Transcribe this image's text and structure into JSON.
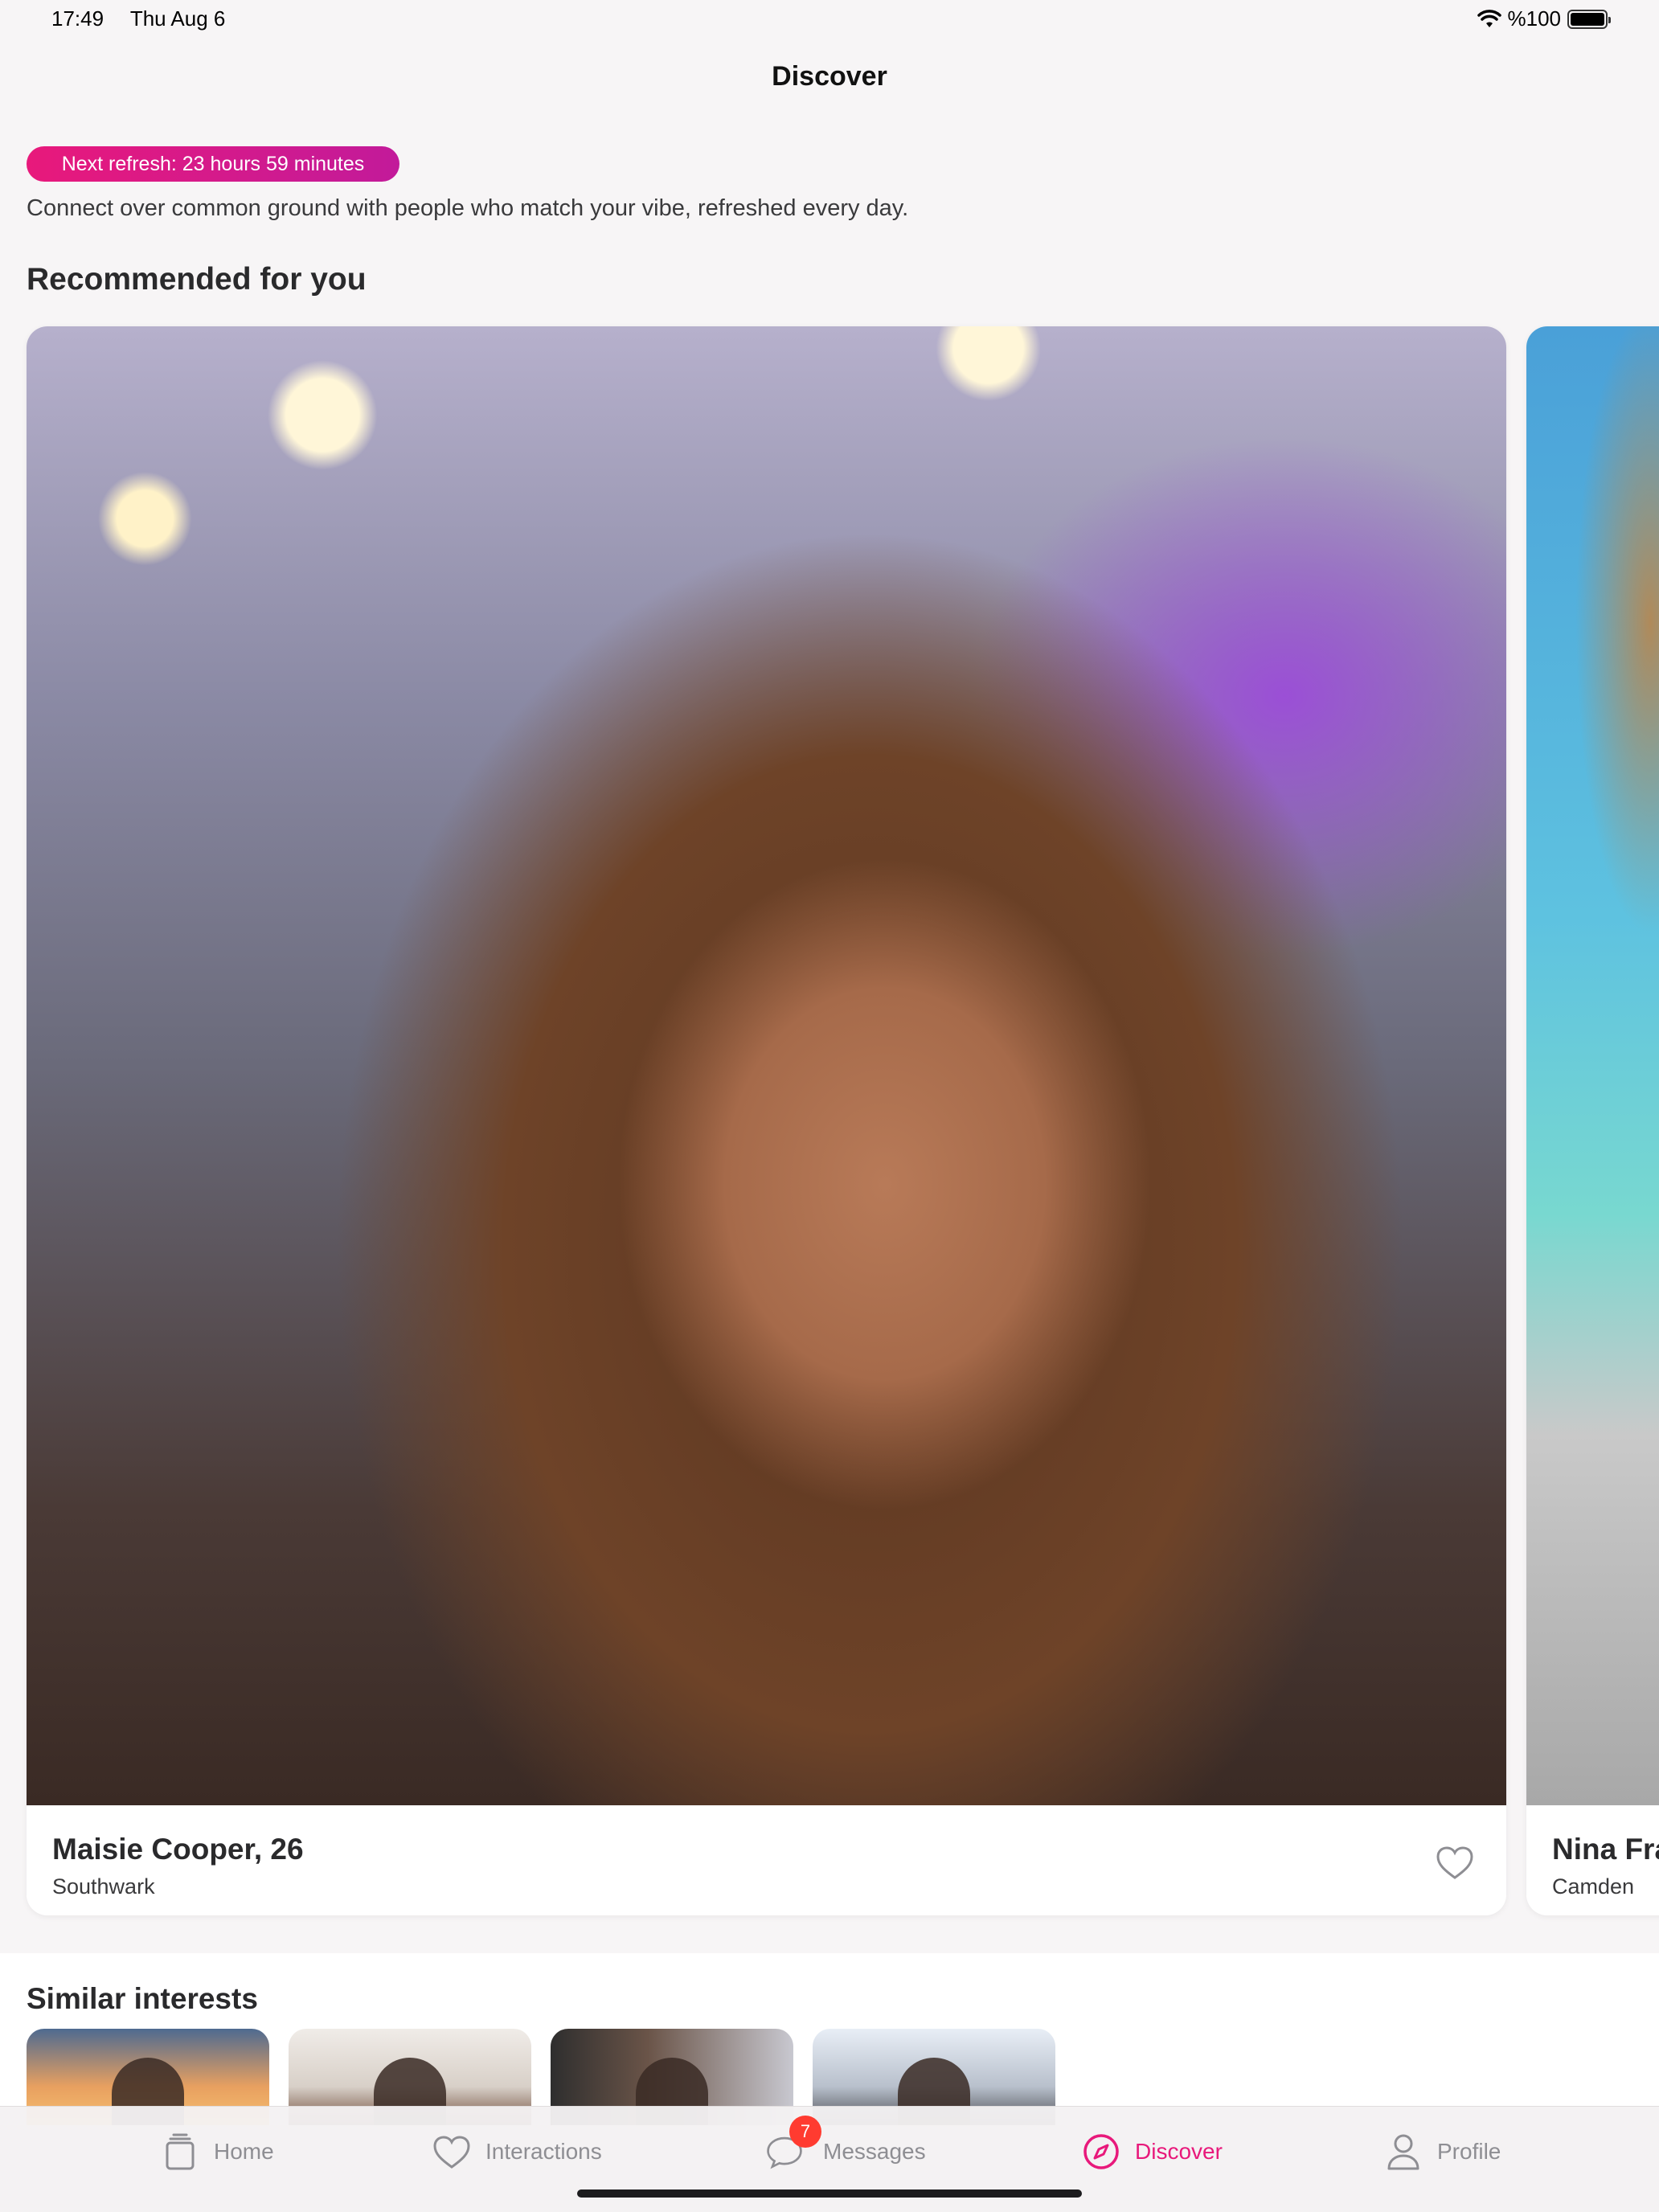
{
  "status_bar": {
    "time": "17:49",
    "date": "Thu Aug 6",
    "battery": "%100"
  },
  "nav": {
    "title": "Discover"
  },
  "refresh": {
    "label": "Next refresh: 23 hours 59 minutes"
  },
  "intro": "Connect over common ground with people who match your vibe, refreshed every day.",
  "sections": {
    "recommended": "Recommended for you",
    "similar": "Similar interests"
  },
  "cards": [
    {
      "name": "Maisie Cooper, 26",
      "location": "Southwark"
    },
    {
      "name": "Nina Fra",
      "location": "Camden"
    }
  ],
  "tabs": {
    "home": "Home",
    "interactions": "Interactions",
    "messages": "Messages",
    "messages_badge": "7",
    "discover": "Discover",
    "profile": "Profile"
  },
  "colors": {
    "accent": "#e8197b",
    "badge": "#ff3b30",
    "inactive_tab": "#8e8e93"
  }
}
